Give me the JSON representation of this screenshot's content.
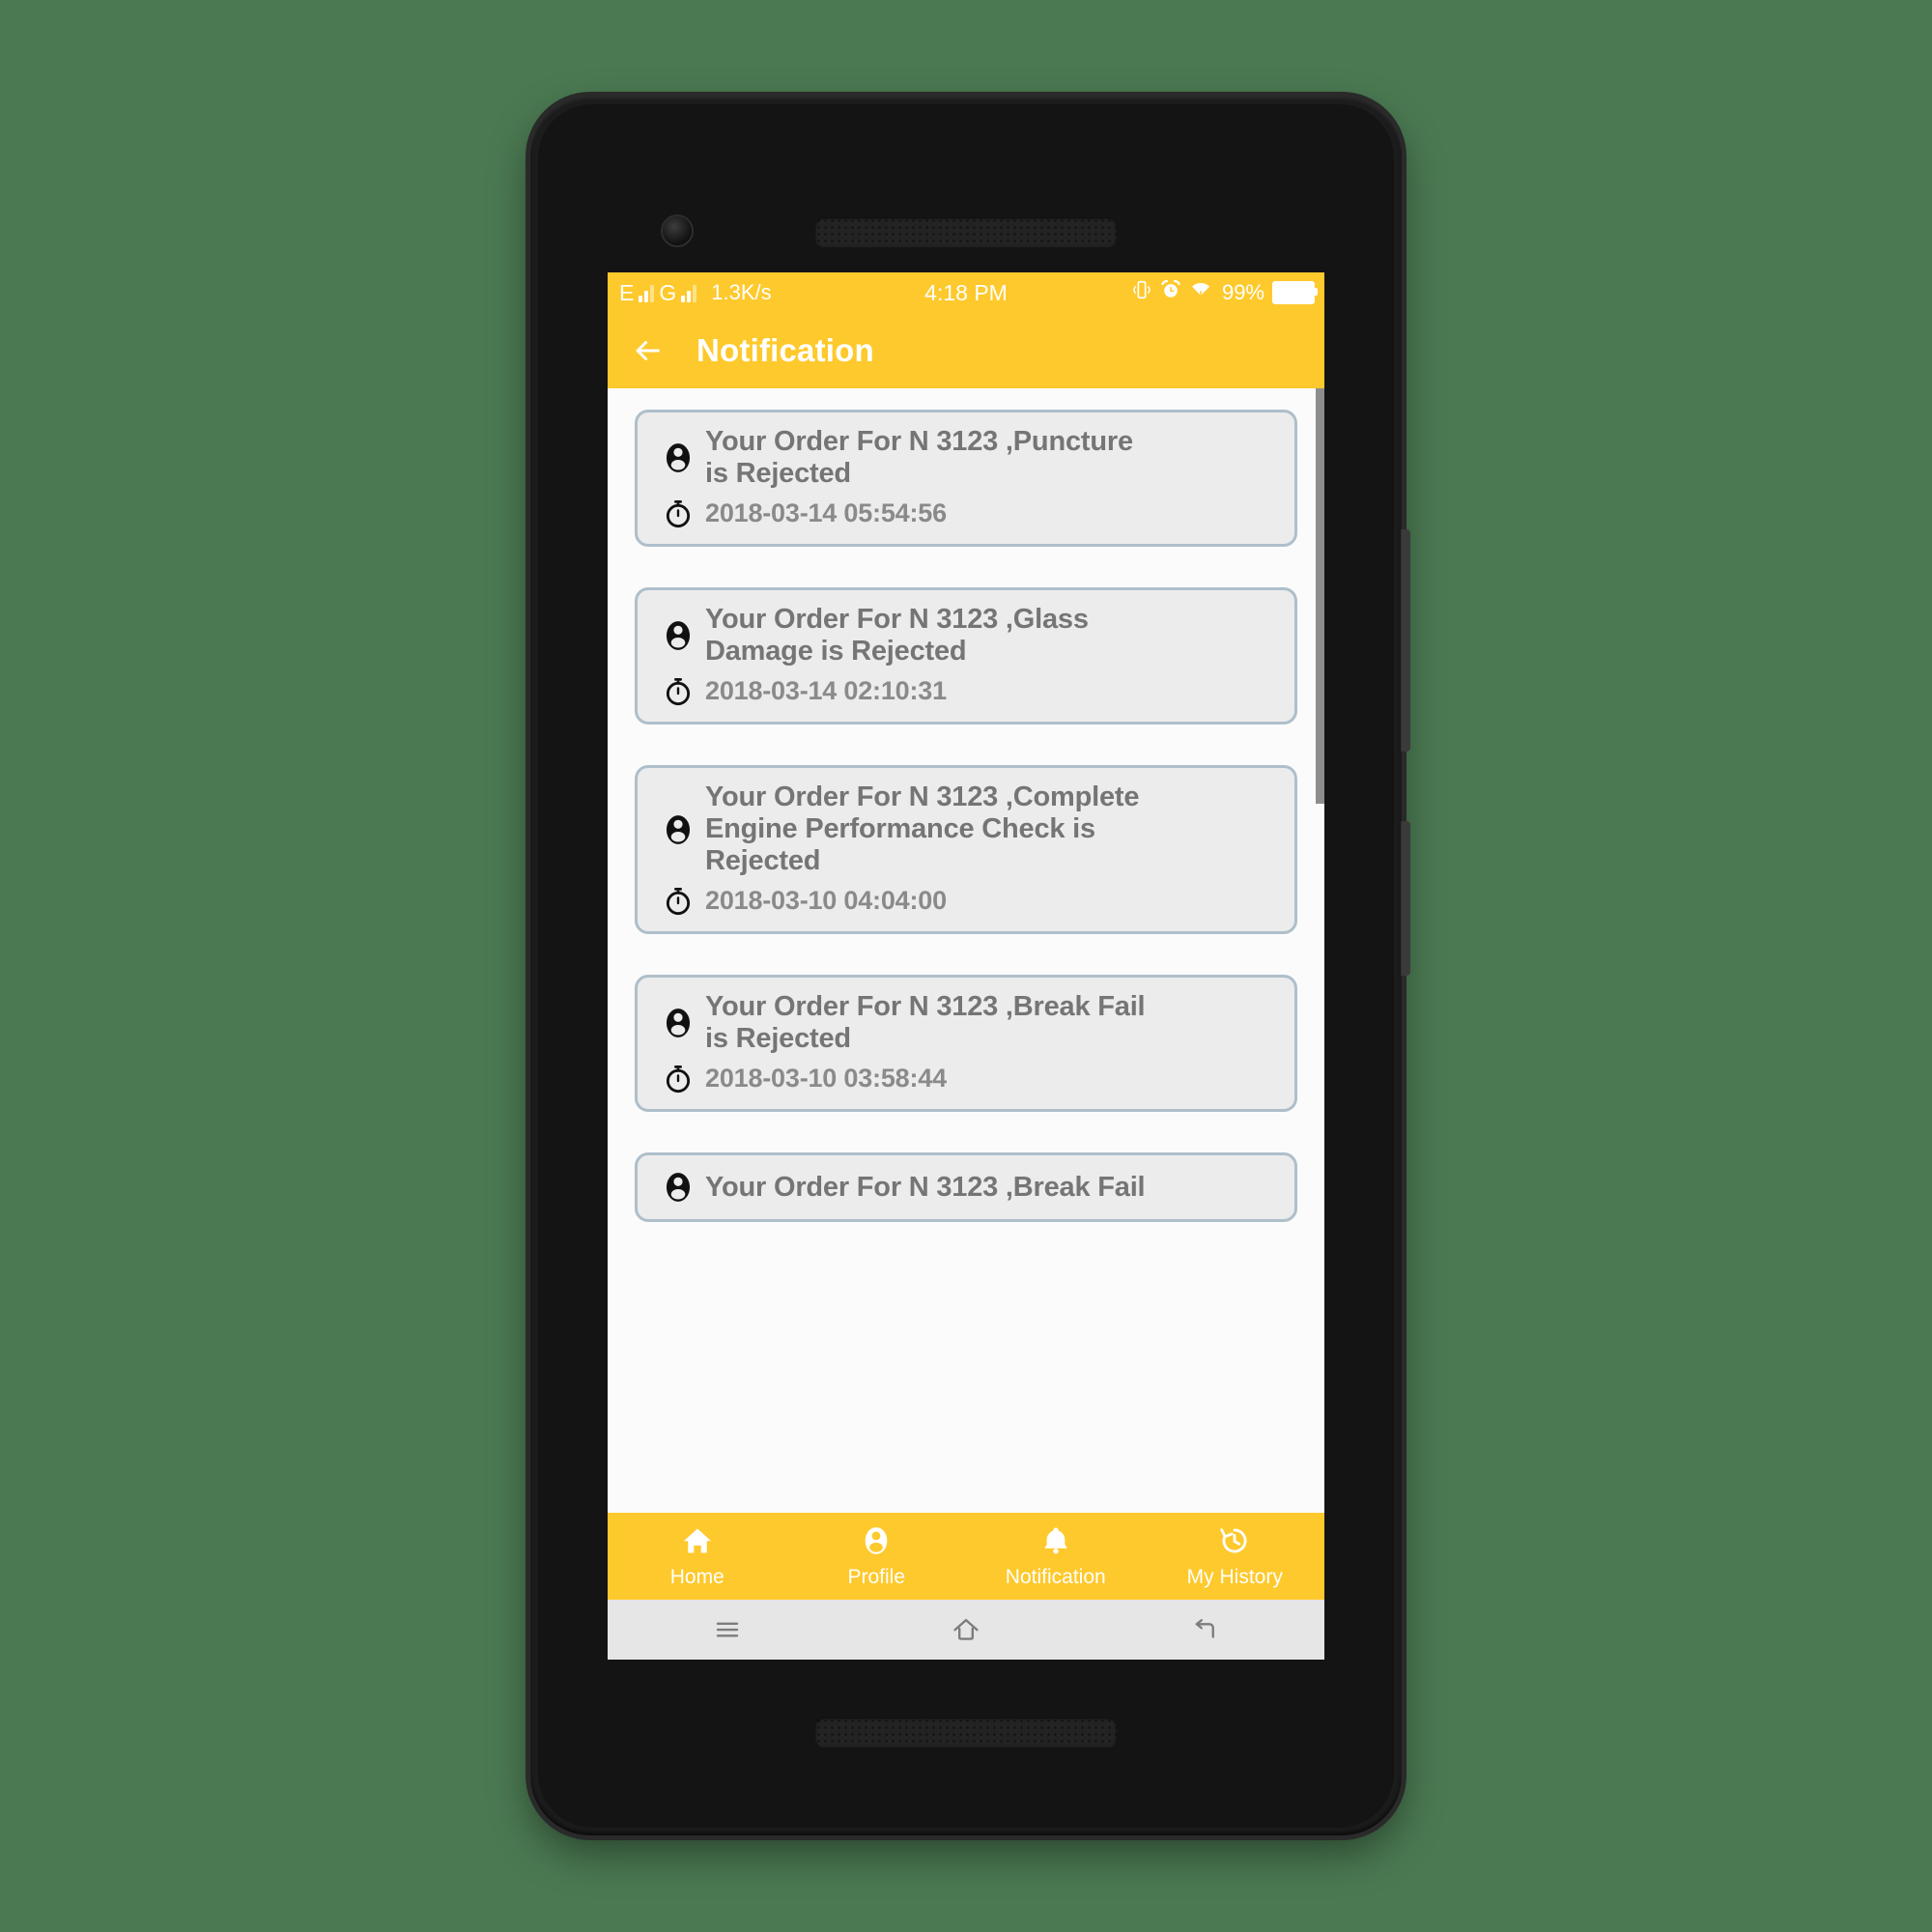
{
  "theme": {
    "accent_yellow": "#fec92c",
    "page_background": "#4b7a52",
    "card_background": "#ececec",
    "card_border": "#aebfca",
    "text_gray": "#757575",
    "system_nav_background": "#e6e6e6"
  },
  "status_bar": {
    "network_type_1": "E",
    "network_type_2": "G",
    "net_speed": "1.3K/s",
    "time": "4:18 PM",
    "battery_percent": "99%",
    "icons": [
      "vibrate-icon",
      "alarm-icon",
      "wifi-icon",
      "battery-icon"
    ]
  },
  "app_bar": {
    "back_icon": "arrow-left-icon",
    "title": "Notification"
  },
  "notifications": [
    {
      "person_icon": "person-icon",
      "title": "Your Order For N 3123 ,Puncture\nis Rejected",
      "time_icon": "stopwatch-icon",
      "time": "2018-03-14 05:54:56"
    },
    {
      "person_icon": "person-icon",
      "title": "Your Order For N 3123 ,Glass\nDamage is Rejected",
      "time_icon": "stopwatch-icon",
      "time": "2018-03-14 02:10:31"
    },
    {
      "person_icon": "person-icon",
      "title": "Your Order For N 3123 ,Complete\nEngine Performance Check is\nRejected",
      "time_icon": "stopwatch-icon",
      "time": "2018-03-10 04:04:00"
    },
    {
      "person_icon": "person-icon",
      "title": "Your Order For N 3123 ,Break Fail\nis Rejected",
      "time_icon": "stopwatch-icon",
      "time": "2018-03-10 03:58:44"
    },
    {
      "person_icon": "person-icon",
      "title": "Your Order For N 3123 ,Break Fail",
      "time_icon": "stopwatch-icon",
      "time": ""
    }
  ],
  "bottom_nav": {
    "items": [
      {
        "icon": "home-icon",
        "label": "Home"
      },
      {
        "icon": "person-icon",
        "label": "Profile"
      },
      {
        "icon": "bell-icon",
        "label": "Notification"
      },
      {
        "icon": "history-icon",
        "label": "My History"
      }
    ],
    "active": "Notification"
  },
  "system_nav": {
    "items": [
      {
        "icon": "menu-icon"
      },
      {
        "icon": "home-outline-icon"
      },
      {
        "icon": "back-arrow-icon"
      }
    ]
  },
  "device": {
    "front_camera": "camera-icon",
    "earpiece": "speaker-grille",
    "bottom_speaker": "speaker-grille",
    "volume_rocker": "volume-button",
    "power_button": "power-button"
  }
}
